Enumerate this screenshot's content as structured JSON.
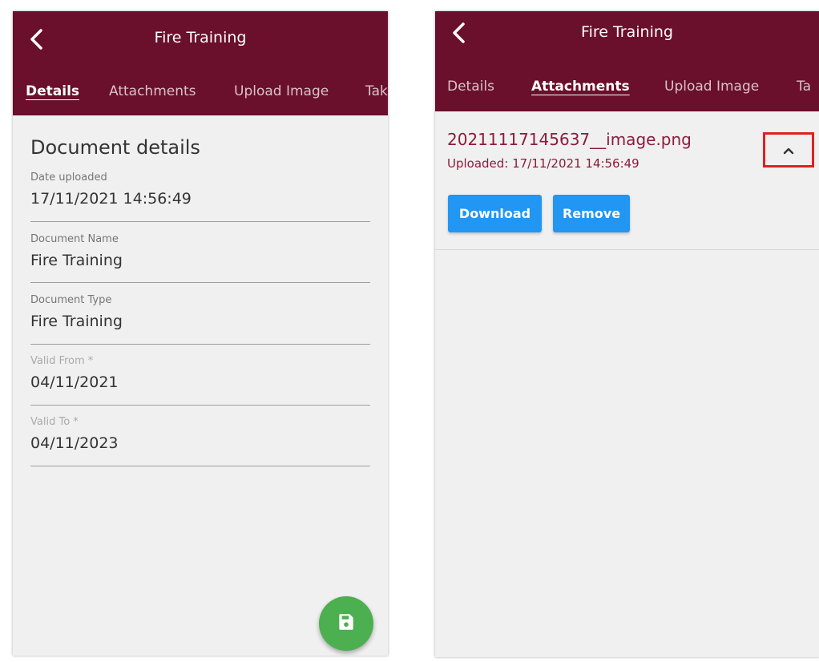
{
  "left_screen": {
    "title": "Fire Training",
    "tabs": [
      {
        "label": "Details",
        "active": true
      },
      {
        "label": "Attachments",
        "active": false
      },
      {
        "label": "Upload Image",
        "active": false
      },
      {
        "label": "Tak",
        "active": false
      }
    ],
    "heading": "Document details",
    "fields": [
      {
        "label": "Date uploaded",
        "value": "17/11/2021 14:56:49"
      },
      {
        "label": "Document Name",
        "value": "Fire Training"
      },
      {
        "label": "Document Type",
        "value": "Fire Training"
      },
      {
        "label": "Valid From *",
        "value": "04/11/2021"
      },
      {
        "label": "Valid To *",
        "value": "04/11/2023"
      }
    ],
    "fab_icon": "save-icon"
  },
  "right_screen": {
    "title": "Fire Training",
    "tabs": [
      {
        "label": "Details",
        "active": false
      },
      {
        "label": "Attachments",
        "active": true
      },
      {
        "label": "Upload Image",
        "active": false
      },
      {
        "label": "Ta",
        "active": false
      }
    ],
    "attachment": {
      "filename": "20211117145637__image.png",
      "uploaded": "Uploaded: 17/11/2021 14:56:49",
      "download_label": "Download",
      "remove_label": "Remove",
      "toggle_icon": "chevron-up-icon"
    }
  },
  "colors": {
    "appbar": "#6a0f2c",
    "accent_text": "#8b1c3c",
    "button_blue": "#2196f3",
    "fab_green": "#4caf50",
    "highlight_red": "#e02020"
  }
}
